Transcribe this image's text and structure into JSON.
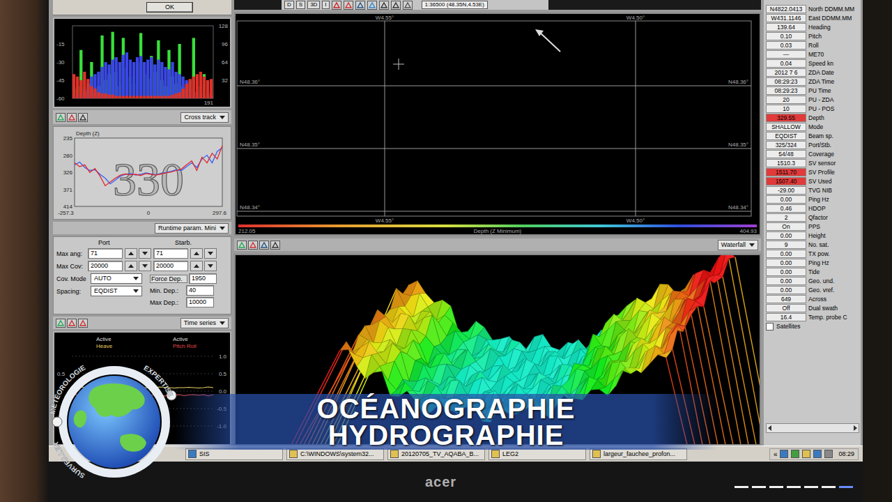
{
  "dialog": {
    "button": "OK"
  },
  "beam_chart": {
    "y_left": [
      "-15",
      "-30",
      "-45",
      "-60"
    ],
    "y_right": [
      "128",
      "96",
      "64",
      "32"
    ],
    "x_end": "191",
    "series": [
      {
        "name": "green",
        "color": "#39e03a",
        "values": [
          -52,
          -50,
          -20,
          -54,
          -48,
          -30,
          -55,
          -50,
          -8,
          -45,
          -40,
          -5,
          -38,
          -50,
          -10,
          -35,
          -42,
          -48,
          -30,
          -6,
          -40,
          -44,
          -25,
          -38,
          -12,
          -45,
          -50,
          -20,
          -42,
          -48,
          -15,
          -50,
          -52,
          -46,
          -10,
          -55,
          -50,
          -40,
          -56,
          -58
        ]
      },
      {
        "name": "blue",
        "color": "#3a46e8",
        "values": [
          -58,
          -57,
          -56,
          -52,
          -48,
          -42,
          -40,
          -38,
          -34,
          -30,
          -32,
          -28,
          -26,
          -30,
          -24,
          -22,
          -28,
          -30,
          -26,
          -25,
          -30,
          -28,
          -26,
          -32,
          -28,
          -30,
          -34,
          -36,
          -30,
          -38,
          -40,
          -42,
          -45,
          -48,
          -52,
          -55,
          -56,
          -57,
          -58,
          -59
        ]
      },
      {
        "name": "red",
        "color": "#e0302a",
        "values": [
          -40,
          -42,
          -45,
          -38,
          -44,
          -50,
          -52,
          -55,
          -56,
          -56,
          -57,
          -57,
          -58,
          -58,
          -58,
          -58,
          -58,
          -58,
          -58,
          -58,
          -58,
          -58,
          -58,
          -58,
          -58,
          -58,
          -58,
          -58,
          -57,
          -56,
          -55,
          -52,
          -48,
          -44,
          -42,
          -40,
          -38,
          -42,
          -45,
          -44
        ]
      }
    ]
  },
  "cross_track": {
    "view": "Cross track",
    "title": "Depth (Z)",
    "big_value": "330",
    "y_ticks": [
      "235",
      "280",
      "326",
      "371",
      "414"
    ],
    "x_ticks": [
      "-257.3",
      "0",
      "297.6"
    ],
    "series": [
      {
        "name": "blue",
        "color": "#3060ff",
        "values": [
          305,
          298,
          312,
          320,
          318,
          330,
          340,
          355,
          345,
          335,
          330,
          328,
          332,
          330,
          326,
          329,
          331,
          327,
          325,
          322,
          318,
          320,
          310,
          300,
          312,
          290,
          280,
          300,
          270,
          260
        ]
      },
      {
        "name": "red",
        "color": "#e02828",
        "values": [
          300,
          310,
          305,
          325,
          315,
          335,
          360,
          350,
          340,
          332,
          329,
          331,
          330,
          333,
          328,
          330,
          332,
          329,
          326,
          324,
          320,
          316,
          305,
          295,
          320,
          285,
          300,
          275,
          290,
          255
        ]
      }
    ]
  },
  "runtime": {
    "view": "Runtime param. Mini",
    "columns": [
      "Port",
      "Starb."
    ],
    "rows": [
      {
        "label": "Max ang:",
        "port": "71",
        "starb": "71"
      },
      {
        "label": "Max Cov:",
        "port": "20000",
        "starb": "20000"
      }
    ],
    "cov_mode": {
      "label": "Cov. Mode",
      "value": "AUTO"
    },
    "spacing": {
      "label": "Spacing:",
      "value": "EQDIST"
    },
    "force_dep": {
      "label": "Force Dep.",
      "value": "1950"
    },
    "min_dep": {
      "label": "Min. Dep.:",
      "value": "40"
    },
    "max_dep": {
      "label": "Max Dep.:",
      "value": "10000"
    }
  },
  "time_series": {
    "view": "Time series",
    "legend": [
      {
        "state": "Active",
        "label": "Heave",
        "color": "#e8d060",
        "values": [
          0.08,
          0.1,
          0.12,
          0.1,
          0.09,
          0.11,
          0.1,
          0.08,
          0.1,
          0.12,
          0.1,
          0.09,
          0.1,
          0.11,
          0.1,
          0.1,
          0.09,
          0.1,
          0.12,
          0.11,
          0.1,
          0.09,
          0.1,
          0.1,
          0.11,
          0.1,
          0.09,
          0.1,
          0.12,
          0.1
        ]
      },
      {
        "state": "Active",
        "label": "Pitch Roll",
        "color": "#e04848",
        "values": [
          -0.12,
          -0.1,
          -0.14,
          -0.1,
          -0.16,
          -0.1,
          -0.12,
          -0.08,
          -0.14,
          -0.1,
          -0.12,
          -0.1,
          -0.15,
          -0.11,
          -0.1,
          -0.13,
          -0.1,
          -0.12,
          -0.09,
          -0.14,
          -0.1,
          -0.12,
          -0.1,
          -0.13,
          -0.11,
          -0.1,
          -0.12,
          -0.1,
          -0.14,
          -0.1
        ]
      }
    ],
    "y_left": [
      "0.5"
    ],
    "y_right": [
      "1.0",
      "0.5",
      "0.0",
      "-0.5",
      "-1.0"
    ]
  },
  "map": {
    "toolbar": [
      "D",
      "S",
      "3D",
      "I"
    ],
    "scale": "1:36500 (48.35N,4.53E)",
    "lon_top": [
      "W4.55°",
      "W4.50°"
    ],
    "lon_bottom": [
      "W4.55°",
      "W4.50°"
    ],
    "lat_left": [
      "N48.36°",
      "N48.35°",
      "N48.34°"
    ],
    "lat_right": [
      "N48.36°",
      "N48.35°",
      "N48.34°"
    ],
    "colorbar": {
      "min": "212.05",
      "label": "Depth (Z Minimum)",
      "max": "404.93"
    }
  },
  "waterfall": {
    "view": "Waterfall"
  },
  "readings": [
    {
      "value": "N4822.0413",
      "label": "North DDMM.MM",
      "alert": false
    },
    {
      "value": "W431.1146",
      "label": "East DDMM.MM",
      "alert": false
    },
    {
      "value": "139.64",
      "label": "Heading",
      "alert": false
    },
    {
      "value": "0.10",
      "label": "Pitch",
      "alert": false
    },
    {
      "value": "0.03",
      "label": "Roll",
      "alert": false
    },
    {
      "value": "—",
      "label": "ME70",
      "alert": false
    },
    {
      "value": "0.04",
      "label": "Speed kn",
      "alert": false
    },
    {
      "value": "2012 7 6",
      "label": "ZDA Date",
      "alert": false
    },
    {
      "value": "08:29:23",
      "label": "ZDA Time",
      "alert": false
    },
    {
      "value": "08:29:23",
      "label": "PU Time",
      "alert": false
    },
    {
      "value": "20",
      "label": "PU - ZDA",
      "alert": false
    },
    {
      "value": "10",
      "label": "PU - POS",
      "alert": false
    },
    {
      "value": "329.55",
      "label": "Depth",
      "alert": true
    },
    {
      "value": "SHALLOW",
      "label": "Mode",
      "alert": false
    },
    {
      "value": "EQDIST",
      "label": "Beam sp.",
      "alert": false
    },
    {
      "value": "325/324",
      "label": "Port/Stb.",
      "alert": false
    },
    {
      "value": "54/48",
      "label": "Coverage",
      "alert": false
    },
    {
      "value": "1510.3",
      "label": "SV sensor",
      "alert": false
    },
    {
      "value": "1511.70",
      "label": "SV Profile",
      "alert": true
    },
    {
      "value": "1507.40",
      "label": "SV Used",
      "alert": true
    },
    {
      "value": "-29.00",
      "label": "TVG NIB",
      "alert": false
    },
    {
      "value": "0.00",
      "label": "Ping Hz",
      "alert": false
    },
    {
      "value": "0.46",
      "label": "HDOP",
      "alert": false
    },
    {
      "value": "2",
      "label": "Qfactor",
      "alert": false
    },
    {
      "value": "On",
      "label": "PPS",
      "alert": false
    },
    {
      "value": "0.00",
      "label": "Height",
      "alert": false
    },
    {
      "value": "9",
      "label": "No. sat.",
      "alert": false
    },
    {
      "value": "0.00",
      "label": "TX pow.",
      "alert": false
    },
    {
      "value": "0.00",
      "label": "Ping Hz",
      "alert": false
    },
    {
      "value": "0.00",
      "label": "Tide",
      "alert": false
    },
    {
      "value": "0.00",
      "label": "Geo. und.",
      "alert": false
    },
    {
      "value": "0.00",
      "label": "Geo. vref.",
      "alert": false
    },
    {
      "value": "649",
      "label": "Across",
      "alert": false
    },
    {
      "value": "Off",
      "label": "Dual swath",
      "alert": false
    },
    {
      "value": "16.4",
      "label": "Temp. probe C",
      "alert": false
    }
  ],
  "satellites": {
    "label": "Satellites",
    "checked": false
  },
  "taskbar": {
    "items": [
      "SIS",
      "C:\\WINDOWS\\system32...",
      "20120705_TV_AQABA_B...",
      "LEG2",
      "largeur_fauchee_profon..."
    ],
    "tray": "«",
    "clock": "08:29"
  },
  "monitor": {
    "brand": "acer"
  },
  "caption": [
    "OCÉANOGRAPHIE",
    "HYDROGRAPHIE"
  ],
  "logo": [
    "SURVEILLER",
    "MÉTÉOROLOGIE",
    "EXPERTISE"
  ]
}
